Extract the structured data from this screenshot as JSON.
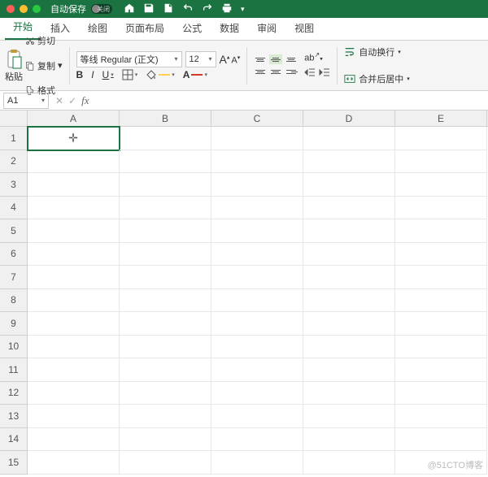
{
  "titlebar": {
    "autosave_label": "自动保存",
    "toggle_off": "关闭",
    "traffic_colors": [
      "#ff5f57",
      "#febc2e",
      "#28c840"
    ]
  },
  "tabs": [
    "开始",
    "插入",
    "绘图",
    "页面布局",
    "公式",
    "数据",
    "审阅",
    "视图"
  ],
  "active_tab_index": 0,
  "clipboard": {
    "paste": "粘贴",
    "cut": "剪切",
    "copy": "复制",
    "format": "格式"
  },
  "font": {
    "name": "等线 Regular (正文)",
    "size": "12",
    "bold": "B",
    "italic": "I",
    "underline": "U",
    "increase": "A",
    "decrease": "A",
    "fontcolor_char": "A",
    "fillcolor": "#ffd24d",
    "fontcolor": "#d23b2a"
  },
  "align": {
    "orient": "abc"
  },
  "wrap": {
    "autowrap": "自动换行",
    "merge": "合并后居中"
  },
  "namebox": "A1",
  "columns": [
    "A",
    "B",
    "C",
    "D",
    "E"
  ],
  "rows": [
    "1",
    "2",
    "3",
    "4",
    "5",
    "6",
    "7",
    "8",
    "9",
    "10",
    "11",
    "12",
    "13",
    "14",
    "15"
  ],
  "selected": {
    "row": 0,
    "col": 0
  },
  "watermark": "@51CTO博客"
}
